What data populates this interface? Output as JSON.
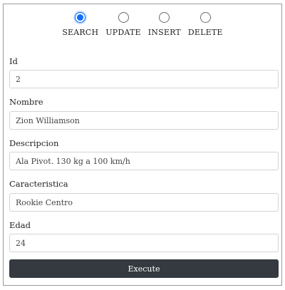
{
  "operations": {
    "selected": "search",
    "options": [
      {
        "id": "search",
        "label": "SEARCH"
      },
      {
        "id": "update",
        "label": "UPDATE"
      },
      {
        "id": "insert",
        "label": "INSERT"
      },
      {
        "id": "delete",
        "label": "DELETE"
      }
    ]
  },
  "form": {
    "id": {
      "label": "Id",
      "value": "2"
    },
    "nombre": {
      "label": "Nombre",
      "value": "Zion Williamson"
    },
    "descripcion": {
      "label": "Descripcion",
      "value": "Ala Pivot. 130 kg a 100 km/h"
    },
    "caracteristica": {
      "label": "Caracteristica",
      "value": "Rookie Centro"
    },
    "edad": {
      "label": "Edad",
      "value": "24"
    }
  },
  "actions": {
    "execute_label": "Execute"
  },
  "colors": {
    "accent": "#0d6efd",
    "button_bg": "#343a40"
  }
}
